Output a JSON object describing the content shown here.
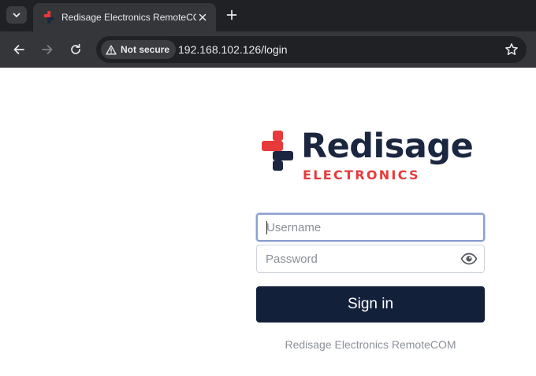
{
  "browser": {
    "tab_title": "Redisage Electronics RemoteCOM",
    "security_label": "Not secure",
    "url": "192.168.102.126/login"
  },
  "brand": {
    "name": "Redisage",
    "subtitle": "ELECTRONICS",
    "primary_color": "#1b2640",
    "accent_color": "#e8393b"
  },
  "login": {
    "username_placeholder": "Username",
    "username_value": "",
    "password_placeholder": "Password",
    "password_value": "",
    "submit_label": "Sign in",
    "footer": "Redisage Electronics RemoteCOM"
  },
  "icons": [
    "chevron-down-icon",
    "close-icon",
    "plus-icon",
    "back-arrow-icon",
    "forward-arrow-icon",
    "reload-icon",
    "warning-icon",
    "star-icon",
    "eye-icon"
  ]
}
